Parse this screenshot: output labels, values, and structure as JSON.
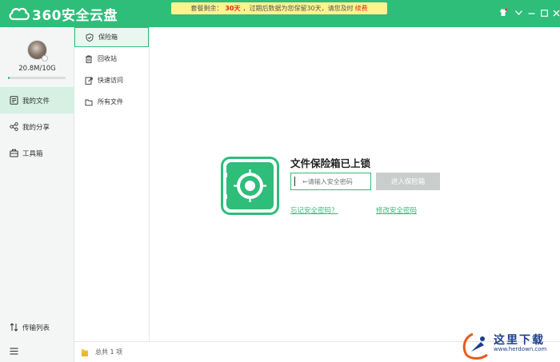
{
  "app": {
    "logo_text": "360安全云盘"
  },
  "notice": {
    "prefix": "套餐剩余：",
    "days": "30天",
    "middle": "，过期后数据为您保留30天，请您及时",
    "renew": "续费"
  },
  "user": {
    "quota_text": "20.8M/10G",
    "quota_fraction": 0.002
  },
  "sidebar": {
    "items": [
      {
        "label": "我的文件",
        "icon": "file-list-icon"
      },
      {
        "label": "我的分享",
        "icon": "share-icon"
      },
      {
        "label": "工具箱",
        "icon": "toolbox-icon"
      }
    ],
    "transfer_label": "传输列表"
  },
  "subnav": {
    "items": [
      {
        "label": "保险箱",
        "icon": "shield-icon"
      },
      {
        "label": "回收站",
        "icon": "trash-icon"
      },
      {
        "label": "快速访问",
        "icon": "quick-access-icon"
      },
      {
        "label": "所有文件",
        "icon": "folder-icon"
      }
    ]
  },
  "vault": {
    "title": "文件保险箱已上锁",
    "placeholder": "←请输入安全密码",
    "enter_label": "进入保险箱",
    "forgot_link": "忘记安全密码？",
    "change_link": "修改安全密码"
  },
  "status": {
    "total_text": "总共 1 项"
  },
  "watermark": {
    "text": "这里下载",
    "url": "www.herdown.com"
  },
  "colors": {
    "accent": "#2fbd7a",
    "notice_bg": "#fff38f",
    "highlight": "#e3261c"
  }
}
